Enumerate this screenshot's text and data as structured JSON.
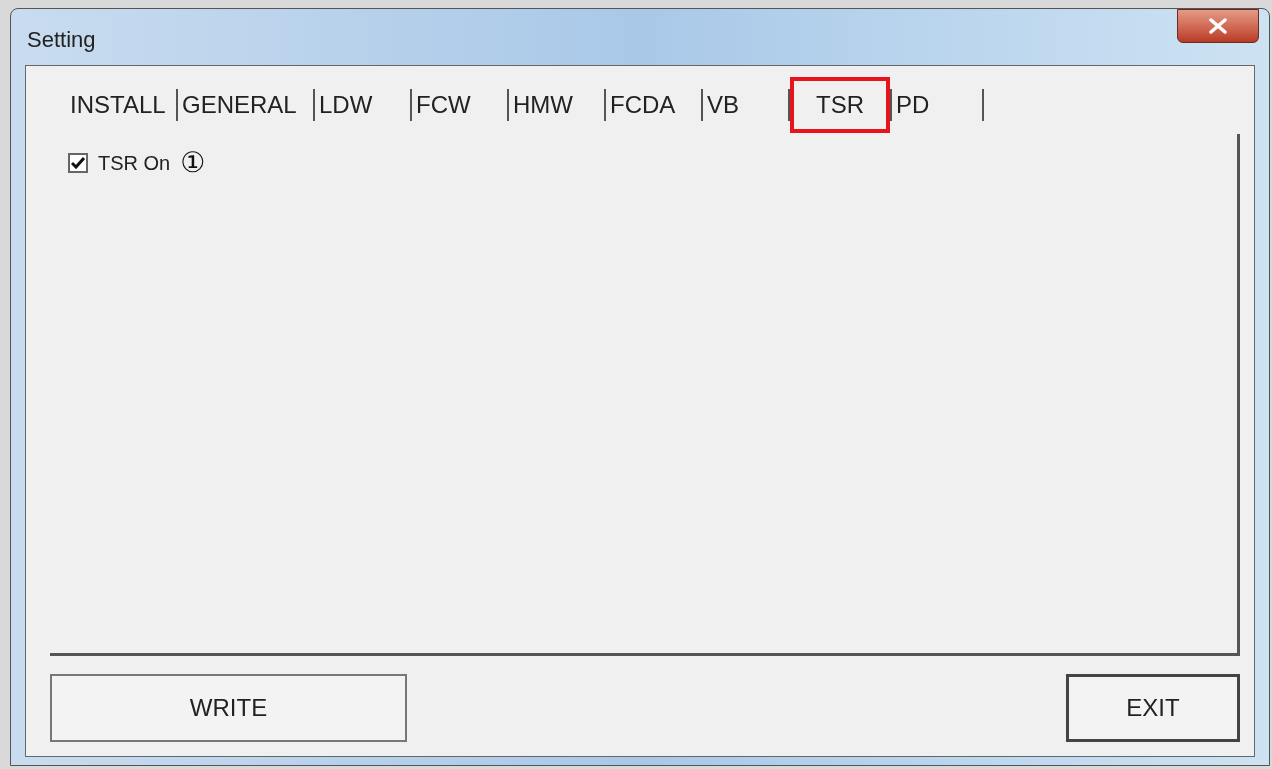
{
  "window": {
    "title": "Setting"
  },
  "tabs": [
    {
      "label": "INSTALL",
      "selected": false
    },
    {
      "label": "GENERAL",
      "selected": false
    },
    {
      "label": "LDW",
      "selected": false
    },
    {
      "label": "FCW",
      "selected": false
    },
    {
      "label": "HMW",
      "selected": false
    },
    {
      "label": "FCDA",
      "selected": false
    },
    {
      "label": "VB",
      "selected": false
    },
    {
      "label": "TSR",
      "selected": true
    },
    {
      "label": "PD",
      "selected": false
    }
  ],
  "options": [
    {
      "label": "TSR On",
      "checked": true,
      "annotation": "①"
    }
  ],
  "buttons": [
    {
      "label": "WRITE"
    },
    {
      "label": "EXIT"
    }
  ]
}
